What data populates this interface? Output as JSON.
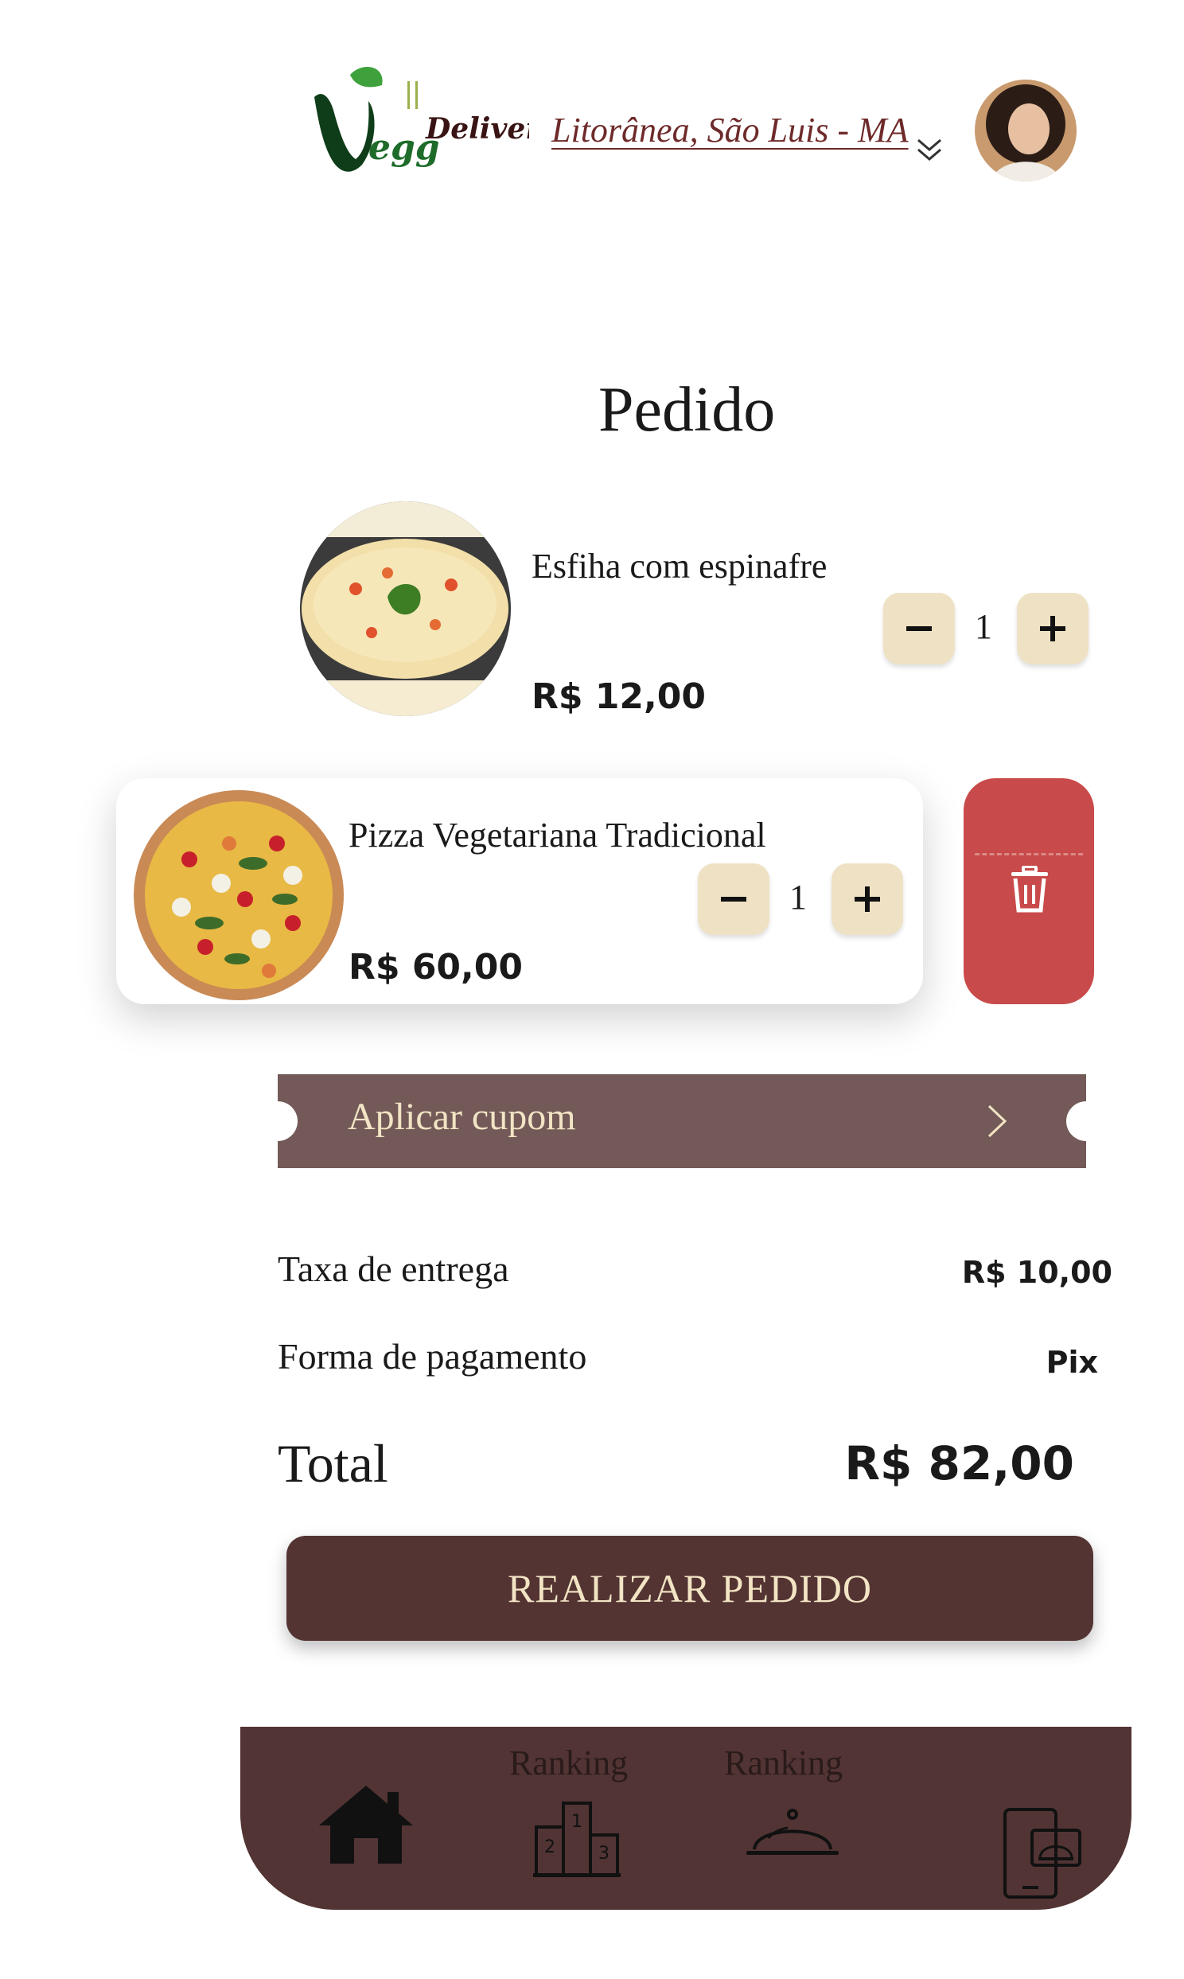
{
  "header": {
    "logo_text": "VeggDelivery",
    "location": "Litorânea, São Luis - MA"
  },
  "page": {
    "title": "Pedido"
  },
  "items": [
    {
      "name": "Esfiha com espinafre",
      "price": "R$ 12,00",
      "quantity": "1"
    },
    {
      "name": "Pizza Vegetariana Tradicional",
      "price": "R$ 60,00",
      "quantity": "1"
    }
  ],
  "coupon": {
    "label": "Aplicar cupom"
  },
  "summary": {
    "delivery_label": "Taxa de entrega",
    "delivery_value": "R$ 10,00",
    "payment_label": "Forma de pagamento",
    "payment_value": "Pix",
    "total_label": "Total",
    "total_value": "R$ 82,00"
  },
  "actions": {
    "order_button": "REALIZAR PEDIDO"
  },
  "bottom_nav": [
    {
      "label": "",
      "icon": "home-icon"
    },
    {
      "label": "Ranking",
      "icon": "podium-icon"
    },
    {
      "label": "Ranking",
      "icon": "cloche-icon"
    },
    {
      "label": "",
      "icon": "phone-order-icon"
    }
  ],
  "colors": {
    "brand_dark": "#533433",
    "coupon_bg": "#735a58",
    "accent_cream": "#efe2c4",
    "delete_red": "#c94a4a",
    "logo_green": "#1e6b2a"
  }
}
